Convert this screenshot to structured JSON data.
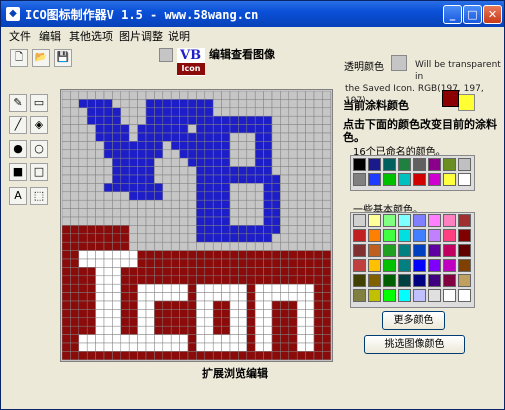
{
  "titlebar": {
    "title": "ICO图标制作器V 1.5 - www.58wang.cn",
    "minimize": "_",
    "maximize": "□",
    "close": "✕"
  },
  "menu": {
    "file": "文件",
    "edit": "编辑",
    "other": "其他选项",
    "image_adjust": "图片调整",
    "help": "说明"
  },
  "toolbar": {
    "new_icon": "new-file-icon",
    "open_icon": "open-folder-icon",
    "save_icon": "save-disk-icon"
  },
  "preview": {
    "logo_top": "VB",
    "logo_bottom": "Icon",
    "label": "编辑查看图像"
  },
  "tools": [
    "pencil-icon",
    "eraser-icon",
    "line-icon",
    "fill-bucket-icon",
    "filled-circle-icon",
    "circle-outline-icon",
    "filled-rect-icon",
    "rect-outline-icon",
    "text-icon",
    "select-icon"
  ],
  "tool_glyphs": [
    "✎",
    "▭",
    "╱",
    "◈",
    "●",
    "○",
    "■",
    "□",
    "A",
    "⬚"
  ],
  "canvas": {
    "label": "扩展浏览编辑",
    "grid_bg": "#c6c6c6",
    "blue": "#1e1ec8",
    "red": "#8b0a0a",
    "white": "#ffffff",
    "gridline": "#808080"
  },
  "transparent": {
    "label": "透明颜色",
    "note_line1": "Will be transparent in",
    "note_line2": "the Saved Icon. RGB(197, 197, 197)"
  },
  "current": {
    "label": "当前涂料颜色",
    "fg": "#8b0000",
    "bg": "#ffff33"
  },
  "palette": {
    "click_label": "点击下面的颜色改变目前的涂料色。",
    "named_label": "16个已命名的颜色。",
    "basic_label": "一些基本颜色。",
    "named_colors": [
      "#000000",
      "#1a1a8c",
      "#006060",
      "#208040",
      "#606060",
      "#8b008b",
      "#6b8e23",
      "#c0c0c0",
      "#808080",
      "#1e3cff",
      "#00c000",
      "#00c0c0",
      "#d00000",
      "#d000d0",
      "#ffff40",
      "#ffffff"
    ],
    "basic_colors": [
      "#d0d0d0",
      "#ffff99",
      "#80ff80",
      "#80ffff",
      "#8080ff",
      "#ff80ff",
      "#ff80c0",
      "#a03030",
      "#c02020",
      "#ff8000",
      "#40ff40",
      "#00e0e0",
      "#4080ff",
      "#c080ff",
      "#ff4080",
      "#800000",
      "#803030",
      "#c06020",
      "#20a020",
      "#008080",
      "#0040c0",
      "#6000a0",
      "#c00060",
      "#600000",
      "#c04040",
      "#ffc000",
      "#00c000",
      "#008080",
      "#0000ff",
      "#8000ff",
      "#c000c0",
      "#804000",
      "#404000",
      "#806000",
      "#006000",
      "#004040",
      "#000080",
      "#400080",
      "#800040",
      "#c0a060",
      "#808040",
      "#c0c000",
      "#00ff00",
      "#00ffff",
      "#c0c0ff",
      "#e0e0e0",
      "#ffffff",
      "#ffffff"
    ],
    "more_button": "更多颜色",
    "pick_button": "挑选图像颜色"
  }
}
